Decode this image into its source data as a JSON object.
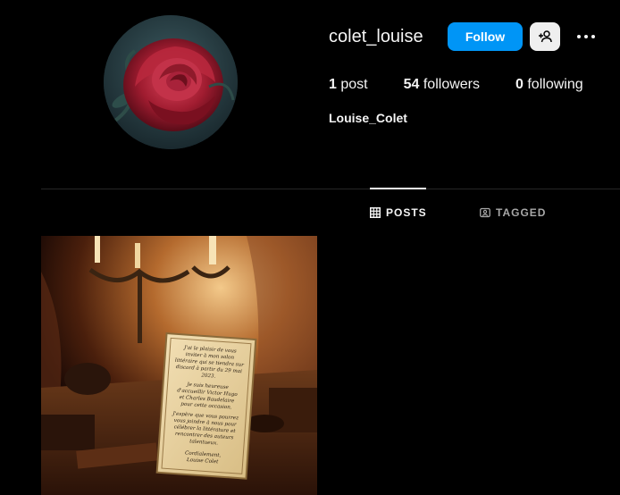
{
  "profile": {
    "username": "colet_louise",
    "full_name": "Louise_Colet",
    "follow_label": "Follow",
    "avatar_icon": "rose-avatar",
    "suggest_icon": "add-user-icon",
    "more_icon": "more-options-icon"
  },
  "stats": {
    "posts_count": "1",
    "posts_label": "post",
    "followers_count": "54",
    "followers_label": "followers",
    "following_count": "0",
    "following_label": "following"
  },
  "tabs": [
    {
      "label": "POSTS",
      "icon": "grid-icon",
      "active": true
    },
    {
      "label": "TAGGED",
      "icon": "tagged-icon",
      "active": false
    }
  ],
  "posts": [
    {
      "letter_lines": [
        "J'ai le plaisir de vous",
        "inviter à mon salon",
        "littéraire qui se tiendra sur",
        "discord à partir du 29 mai",
        "2023.",
        "Je suis heureuse",
        "d'accueillir Victor Hugo",
        "et Charles Baudelaire",
        "pour cette occasion.",
        "J'espère que vous pourrez",
        "vous joindre à nous pour",
        "célébrer la littérature et",
        "rencontrer des auteurs",
        "talentueux.",
        "Cordialement,",
        "Louise Colet"
      ]
    }
  ],
  "colors": {
    "background": "#000000",
    "follow_button": "#0095f6",
    "active_tab": "#f5f5f5",
    "inactive_tab": "#a8a8a8"
  }
}
